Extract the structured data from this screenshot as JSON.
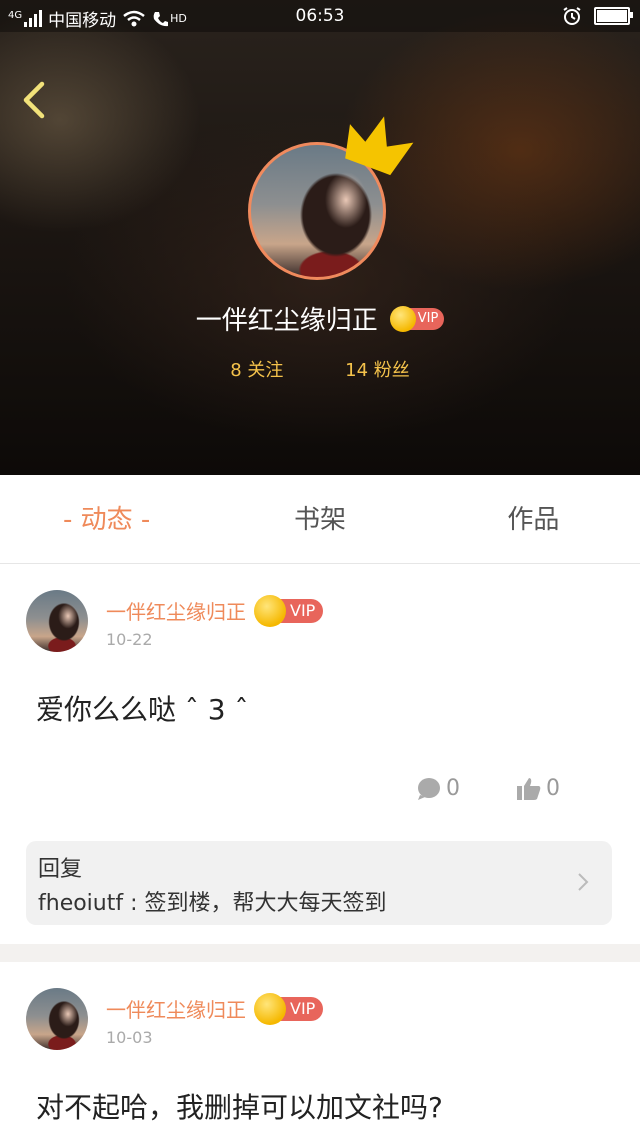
{
  "status_bar": {
    "network": "4G",
    "carrier": "中国移动",
    "hd": "HD",
    "time": "06:53"
  },
  "profile": {
    "username": "一伴红尘缘归正",
    "vip_label": "VIP",
    "following": "8 关注",
    "followers": "14 粉丝"
  },
  "tabs": [
    {
      "label": "- 动态 -",
      "active": true
    },
    {
      "label": "书架",
      "active": false
    },
    {
      "label": "作品",
      "active": false
    }
  ],
  "posts": [
    {
      "author": "一伴红尘缘归正",
      "vip_label": "VIP",
      "date": "10-22",
      "content": "爱你么么哒 ˆ 3 ˆ",
      "comments": "0",
      "likes": "0",
      "reply": {
        "title": "回复",
        "text": "fheoiutf : 签到楼，帮大大每天签到"
      }
    },
    {
      "author": "一伴红尘缘归正",
      "vip_label": "VIP",
      "date": "10-03",
      "content": "对不起哈，我删掉可以加文社吗?"
    }
  ],
  "colors": {
    "accent": "#ef8a5a",
    "vip_red": "#e8655b",
    "gold": "#f4c24b"
  }
}
